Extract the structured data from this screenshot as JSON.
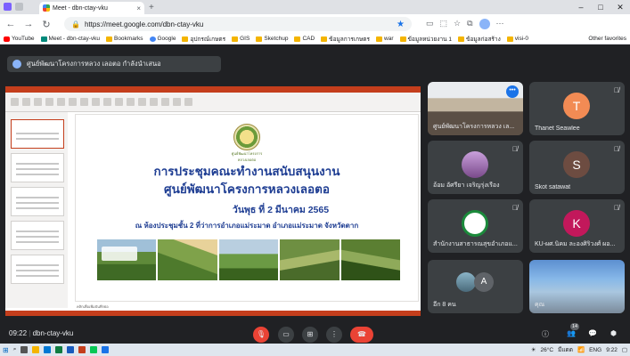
{
  "browser": {
    "tab_title": "Meet - dbn-ctay-vku",
    "url": "https://meet.google.com/dbn-ctay-vku",
    "bookmarks": [
      "YouTube",
      "Meet - dbn-ctay-vku",
      "Bookmarks",
      "Google",
      "อุปกรณ์เกษตร",
      "GIS",
      "Sketchup",
      "CAD",
      "ข้อมูลการเกษตร",
      "war",
      "ข้อมูลหน่วยงาน 1",
      "ข้อมูลก่อสร้าง",
      "visi-0"
    ],
    "other_bookmarks": "Other favorites"
  },
  "meet": {
    "presenting_text": "ศูนย์พัฒนาโครงการหลวง เลอตอ กำลังนำเสนอ",
    "meeting_time": "09:22",
    "meeting_code": "dbn-ctay-vku",
    "participant_badge": "14"
  },
  "slide": {
    "seal_caption": "ศูนย์พัฒนาโครงการหลวงเลอตอ",
    "title_line1": "การประชุมคณะทำงานสนับสนุนงาน",
    "title_line2": "ศูนย์พัฒนาโครงการหลวงเลอตอ",
    "date": "วันพุธ ที่  2  มีนาคม 2565",
    "venue": "ณ ห้องประชุมชั้น 2  ที่ว่าการอำเภอแม่ระมาด  อำเภอแม่ระมาด จังหวัดตาก",
    "notes_placeholder": "คลิกเพื่อเพิ่มบันทึกย่อ"
  },
  "tiles": [
    {
      "name": "ศูนย์พัฒนาโครงการหลวง เล...",
      "type": "video"
    },
    {
      "name": "Thanet Seawlee",
      "initial": "T",
      "color": "#f28b54"
    },
    {
      "name": "อ้อม อัศรียา เจริญรุ่งเรือง",
      "type": "photo"
    },
    {
      "name": "Skot satawat",
      "initial": "S",
      "color": "#6d4c41"
    },
    {
      "name": "สำนักงานสาธารณสุขอำเภอแ...",
      "type": "logo"
    },
    {
      "name": "KU-ผศ.นิคม ละองศิริวงศ์ ผอ...",
      "initial": "K",
      "color": "#c2185b"
    },
    {
      "name": "อีก 8 คน",
      "initial": "A",
      "color": "#5f6368"
    },
    {
      "name": "คุณ",
      "type": "self"
    }
  ],
  "taskbar": {
    "weather": "26°C",
    "weather_text": "มีแดด",
    "lang": "ENG",
    "clock": "9:22"
  }
}
